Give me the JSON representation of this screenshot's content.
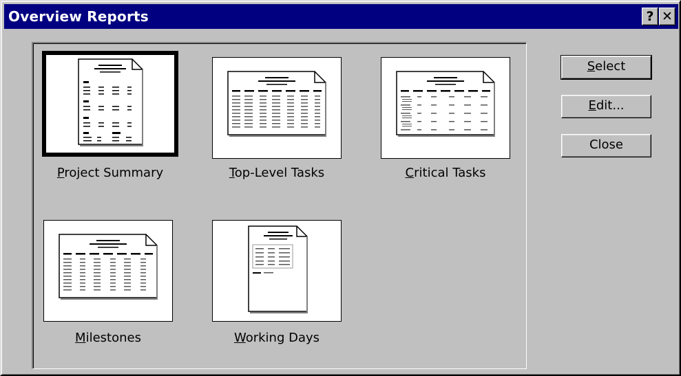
{
  "window": {
    "title": "Overview Reports",
    "help_glyph": "?",
    "close_glyph": "✕"
  },
  "reports": [
    {
      "accel": "P",
      "rest": "roject Summary",
      "selected": true,
      "icon": "project-summary-report-icon"
    },
    {
      "accel": "T",
      "rest": "op-Level Tasks",
      "selected": false,
      "icon": "top-level-tasks-report-icon"
    },
    {
      "accel": "C",
      "rest": "ritical Tasks",
      "selected": false,
      "icon": "critical-tasks-report-icon"
    },
    {
      "accel": "M",
      "rest": "ilestones",
      "selected": false,
      "icon": "milestones-report-icon"
    },
    {
      "accel": "W",
      "rest": "orking Days",
      "selected": false,
      "icon": "working-days-report-icon"
    }
  ],
  "buttons": {
    "select": {
      "accel": "S",
      "rest": "elect"
    },
    "edit": {
      "accel": "E",
      "rest": "dit..."
    },
    "close": {
      "accel": "",
      "rest": "Close"
    }
  }
}
